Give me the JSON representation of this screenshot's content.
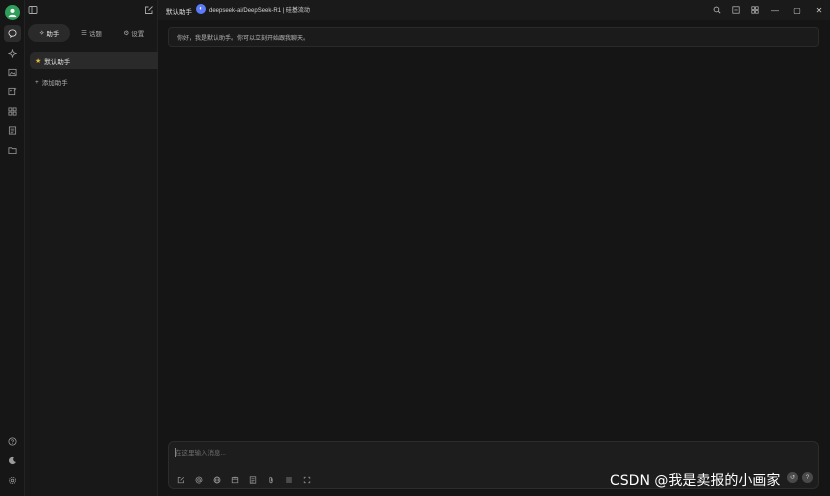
{
  "rail": {
    "items": [
      "chat",
      "sparkle",
      "image",
      "image-edit",
      "apps",
      "notes",
      "folder"
    ],
    "bottom": [
      "help",
      "theme",
      "settings"
    ]
  },
  "panel": {
    "tabs": [
      {
        "icon": "✧",
        "label": "助手"
      },
      {
        "icon": "☰",
        "label": "话题"
      },
      {
        "icon": "⚙",
        "label": "设置"
      }
    ],
    "assistant": {
      "star": "★",
      "label": "默认助手",
      "badge": "!"
    },
    "add_label": "添加助手",
    "add_icon": "+"
  },
  "titlebar": {
    "assistant_name": "默认助手",
    "model_label": "deepseek-ai/DeepSeek-R1 | 硅基流动",
    "model_logo": "◐",
    "window_buttons": {
      "minimize": "—",
      "maximize": "▢",
      "close": "✕"
    }
  },
  "main": {
    "greeting": "你好，我是默认助手。你可以立刻开始跟我聊天。",
    "input_placeholder": "在这里输入消息...",
    "send_icons": [
      "↺",
      "?"
    ]
  },
  "watermark": "CSDN @我是卖报的小画家",
  "colors": {
    "accent_green": "#2f9e5a",
    "star": "#e8b83a",
    "model_logo": "#5b7cf7"
  }
}
